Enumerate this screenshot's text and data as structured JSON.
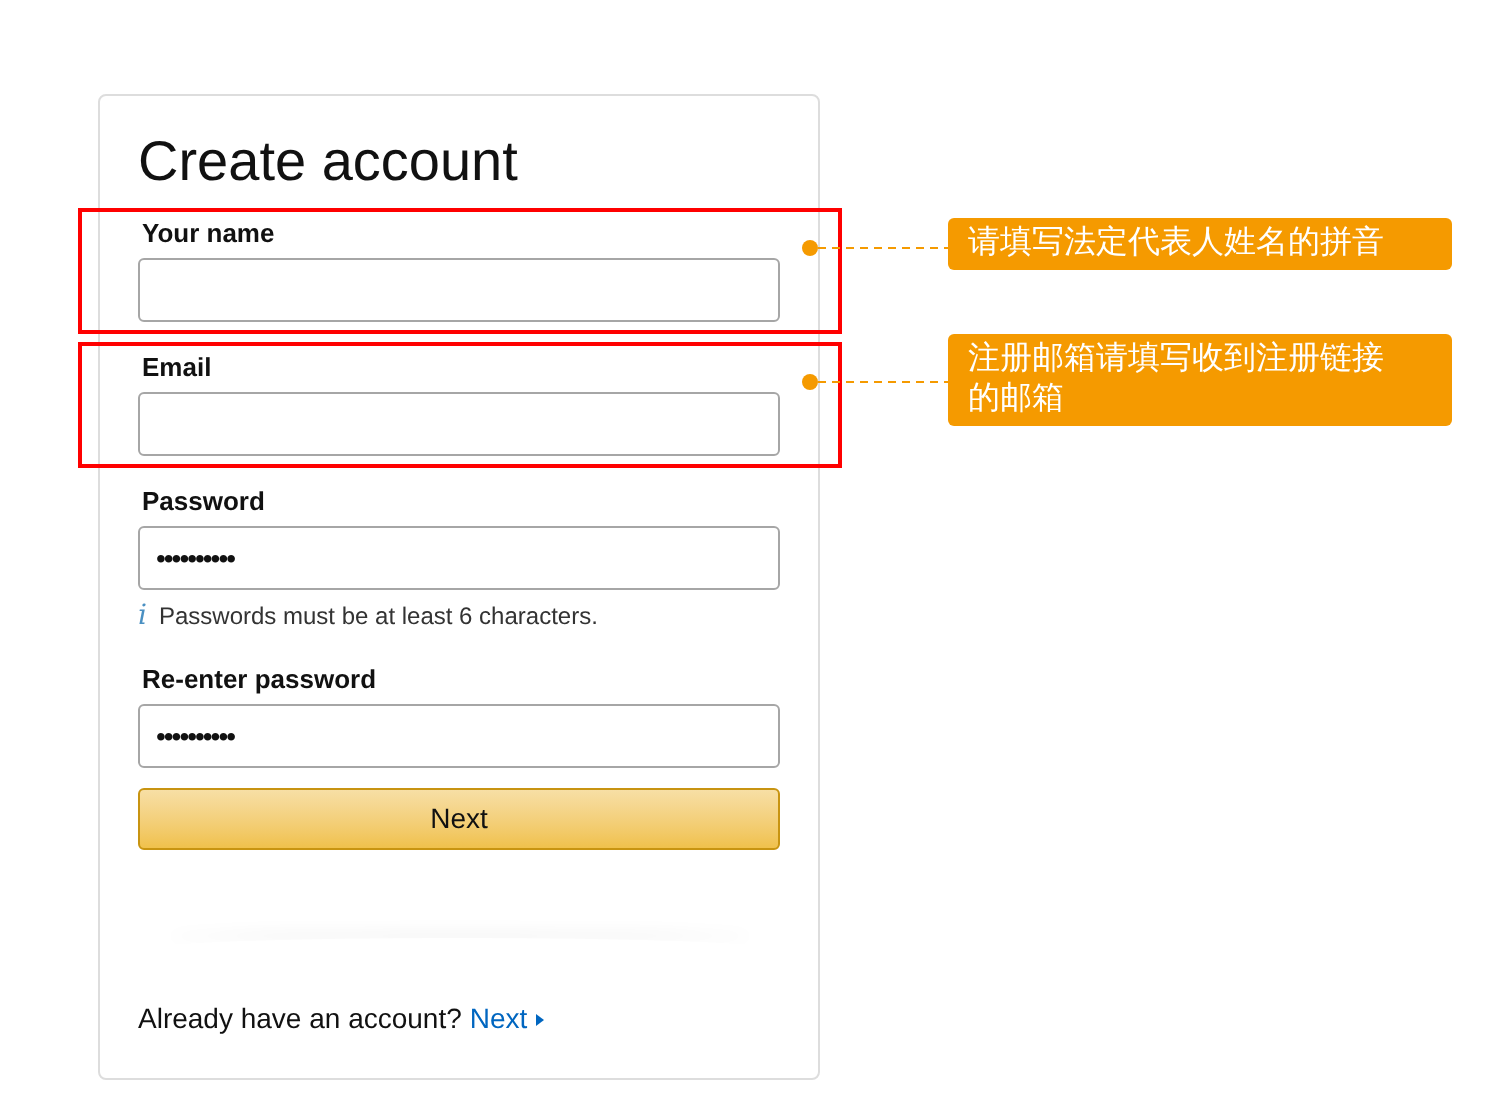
{
  "title": "Create account",
  "fields": [
    {
      "label": "Your name",
      "highlighted": true
    },
    {
      "label": "Email",
      "highlighted": true
    },
    {
      "label": "Password",
      "value": "••••••••••",
      "highlighted": false,
      "hint_icon": "i",
      "hint": "Passwords must be at least 6 characters."
    },
    {
      "label": "Re-enter password",
      "value": "••••••••••",
      "highlighted": false
    }
  ],
  "button": "Next",
  "footer": {
    "text": "Already have an account?",
    "link": "Next"
  },
  "annotations": [
    {
      "text": "请填写法定代表人姓名的拼音"
    },
    {
      "text": "注册邮箱请填写收到注册链接的邮箱"
    }
  ]
}
